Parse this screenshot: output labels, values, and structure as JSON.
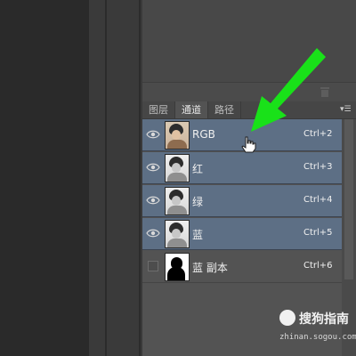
{
  "tabs": [
    "图层",
    "通道",
    "路径"
  ],
  "active_tab": "通道",
  "channels": [
    {
      "label": "RGB",
      "shortcut": "Ctrl+2",
      "selected": true,
      "visible": true,
      "thumb": "color"
    },
    {
      "label": "红",
      "shortcut": "Ctrl+3",
      "selected": true,
      "visible": true,
      "thumb": "gray"
    },
    {
      "label": "绿",
      "shortcut": "Ctrl+4",
      "selected": true,
      "visible": true,
      "thumb": "gray"
    },
    {
      "label": "蓝",
      "shortcut": "Ctrl+5",
      "selected": true,
      "visible": true,
      "thumb": "gray"
    },
    {
      "label": "蓝 副本",
      "shortcut": "Ctrl+6",
      "selected": false,
      "visible": false,
      "thumb": "mask"
    }
  ],
  "watermark": {
    "brand": "搜狗指南",
    "url": "zhinan.sogou.com"
  },
  "colors": {
    "arrow": "#19e119",
    "selected_row": "#5d6f85"
  },
  "icons": [
    "eye-icon",
    "trash-icon",
    "panel-menu-icon",
    "hand-cursor-icon",
    "arrow-annotation-icon",
    "sogou-logo-icon"
  ]
}
